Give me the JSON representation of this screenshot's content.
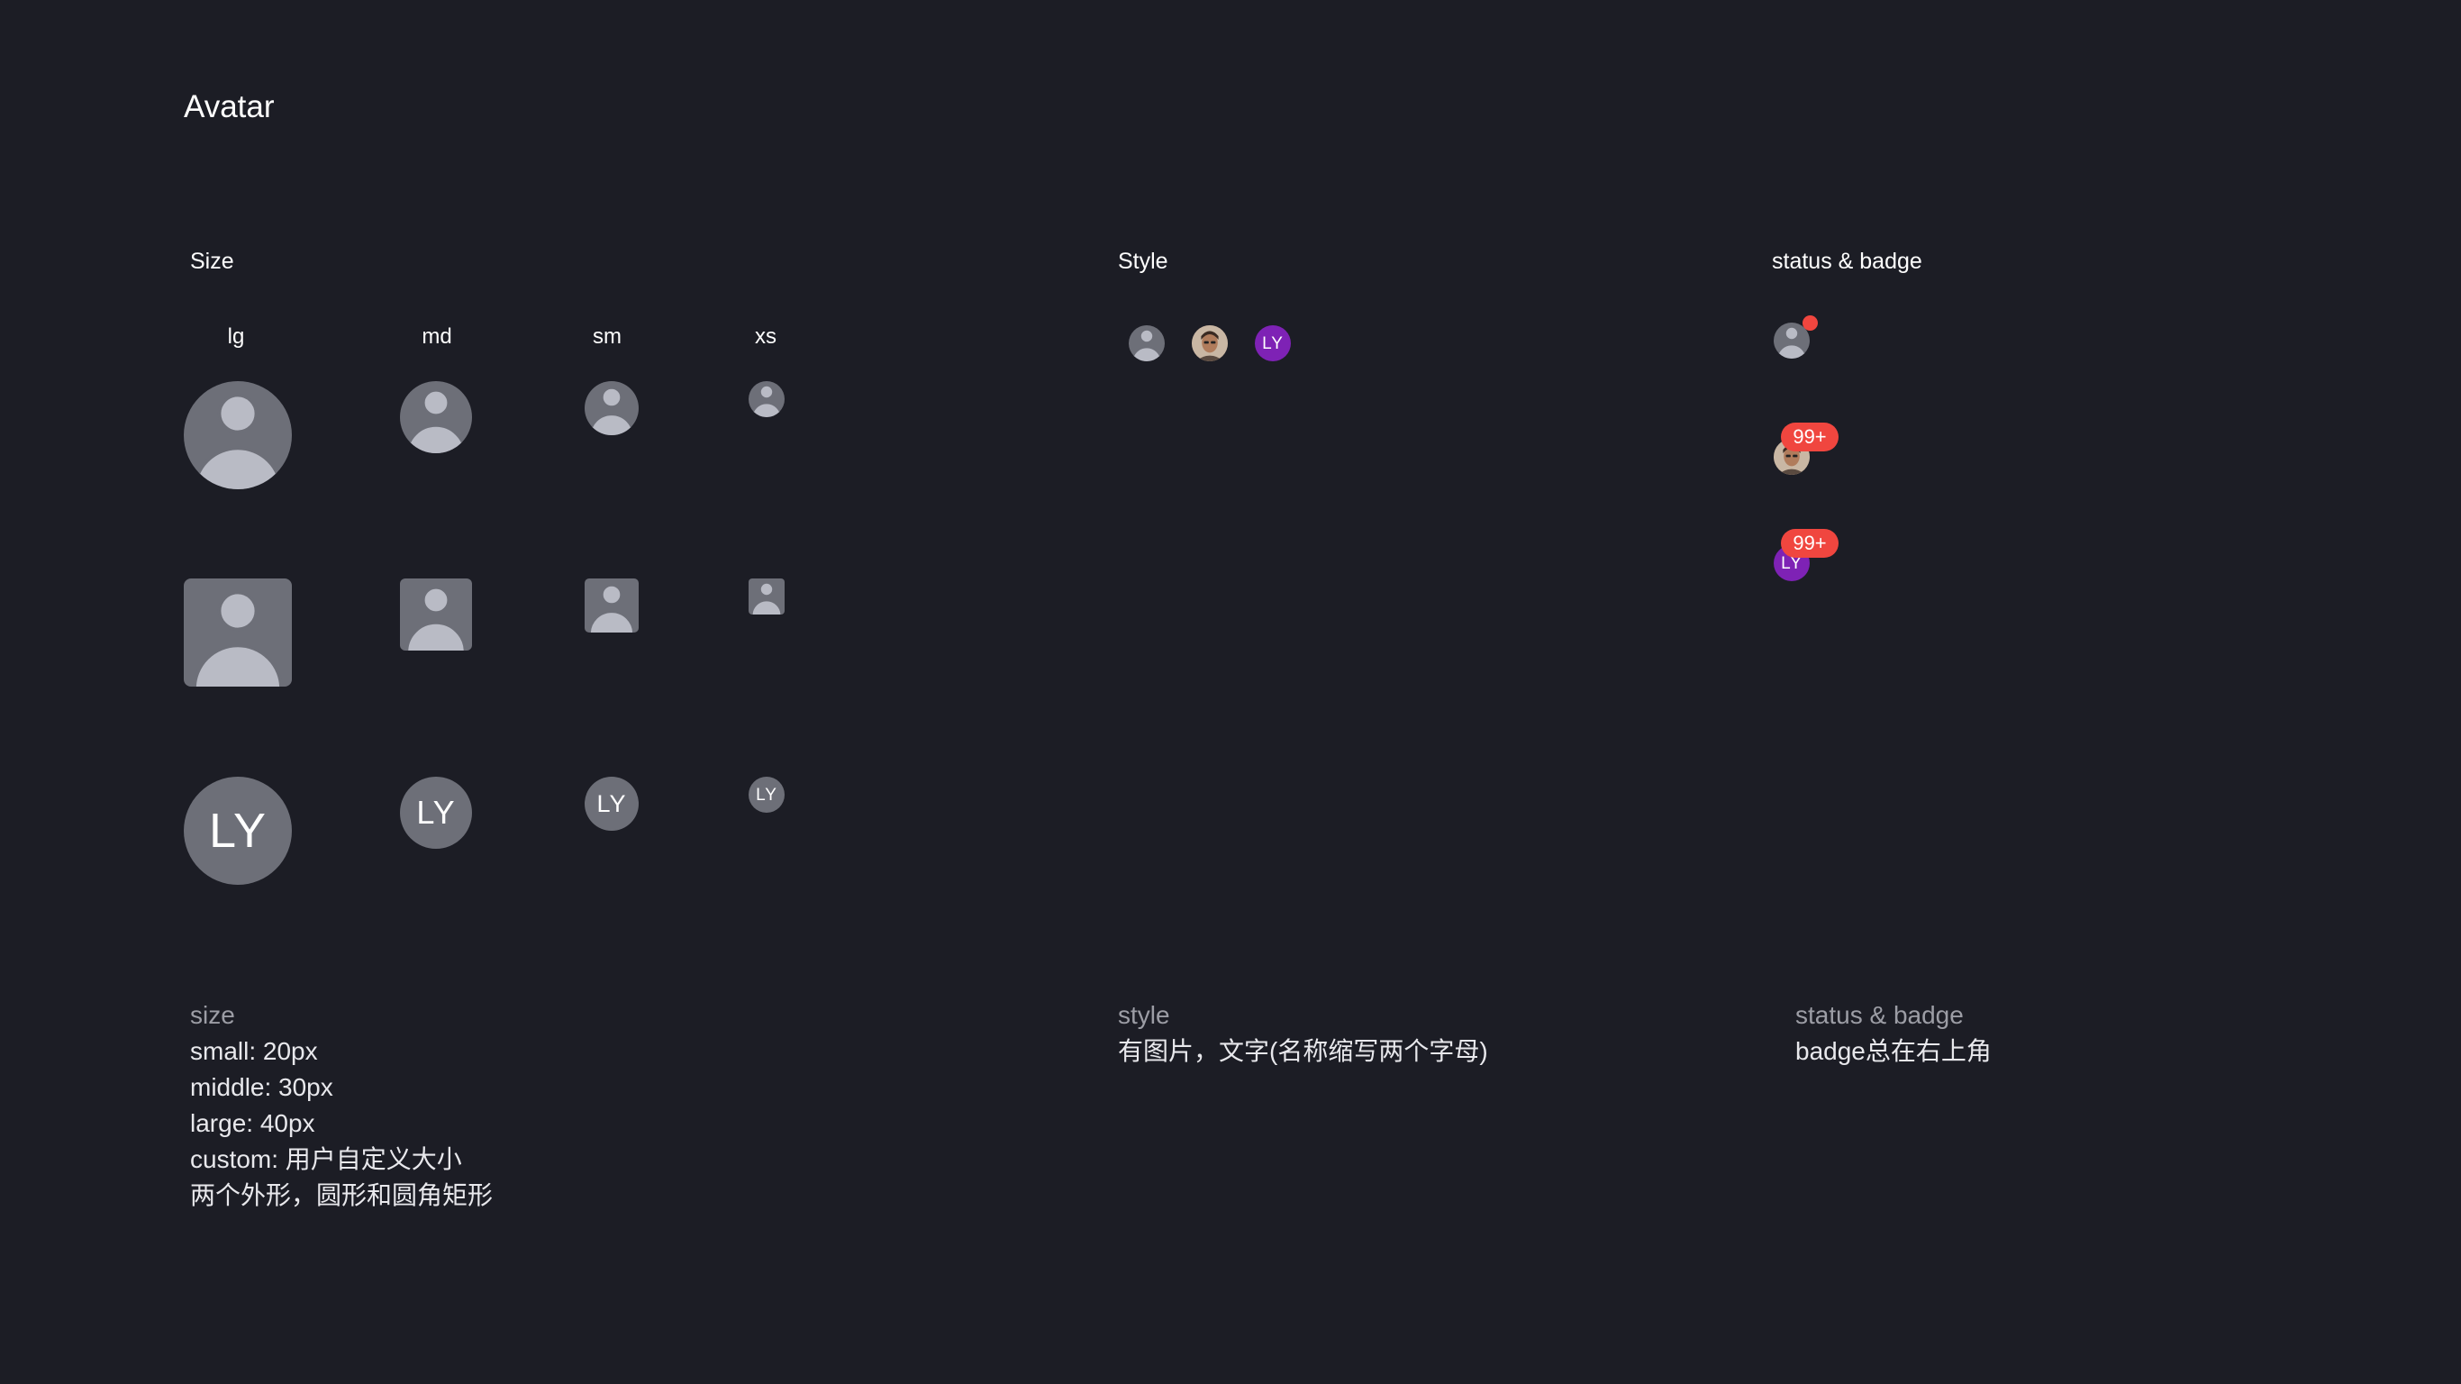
{
  "page": {
    "title": "Avatar"
  },
  "sections": {
    "size": {
      "title": "Size",
      "labels": [
        "lg",
        "md",
        "sm",
        "xs"
      ]
    },
    "style": {
      "title": "Style"
    },
    "status": {
      "title": "status & badge"
    }
  },
  "avatar": {
    "initials": "LY",
    "placeholder_icon": "user-silhouette-icon",
    "photo_icon": "person-photo-icon"
  },
  "badges": {
    "count_label": "99+"
  },
  "notes": {
    "size": {
      "heading": "size",
      "lines": [
        "small: 20px",
        "middle: 30px",
        "large: 40px",
        "custom: 用户自定义大小",
        "两个外形，圆形和圆角矩形"
      ]
    },
    "style": {
      "heading": "style",
      "lines": [
        "有图片，文字(名称缩写两个字母)"
      ]
    },
    "status": {
      "heading": "status & badge",
      "lines": [
        "badge总在右上角"
      ]
    }
  },
  "colors": {
    "background": "#1c1d25",
    "avatar_fill": "#6d6f78",
    "silhouette": "#b9bbc5",
    "brand_purple": "#7e22b5",
    "badge_red": "#f0463f",
    "note_heading": "#9c9da5"
  }
}
